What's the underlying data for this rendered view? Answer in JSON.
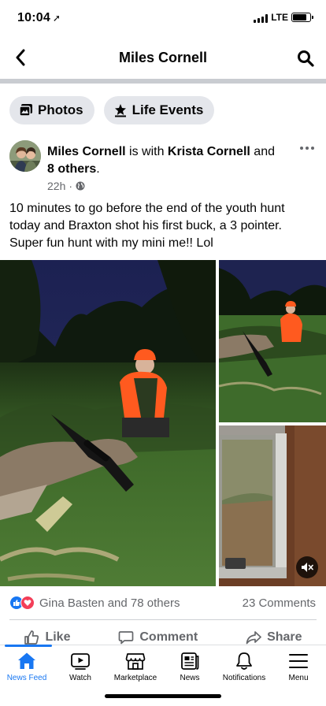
{
  "status_bar": {
    "time": "10:04",
    "network": "LTE"
  },
  "header": {
    "title": "Miles Cornell"
  },
  "chips": [
    {
      "label": "Photos"
    },
    {
      "label": "Life Events"
    }
  ],
  "post": {
    "author": "Miles Cornell",
    "with_text": " is with ",
    "tagged": "Krista Cornell",
    "and_text": " and ",
    "others": "8 others",
    "period": ".",
    "time": "22h",
    "dot": "·",
    "text": "10 minutes to go before the end of the youth hunt today and Braxton shot his first buck, a 3 pointer. Super fun hunt with my mini me!! Lol"
  },
  "reactions": {
    "summary": "Gina Basten and 78 others",
    "comments": "23 Comments"
  },
  "actions": [
    {
      "label": "Like"
    },
    {
      "label": "Comment"
    },
    {
      "label": "Share"
    }
  ],
  "tabs": [
    {
      "label": "News Feed",
      "icon": "home-icon",
      "active": true
    },
    {
      "label": "Watch",
      "icon": "watch-icon"
    },
    {
      "label": "Marketplace",
      "icon": "marketplace-icon"
    },
    {
      "label": "News",
      "icon": "news-icon"
    },
    {
      "label": "Notifications",
      "icon": "bell-icon"
    },
    {
      "label": "Menu",
      "icon": "menu-icon"
    }
  ],
  "colors": {
    "accent": "#1877f2",
    "secondary_text": "#65676b",
    "chip_bg": "#e4e6eb",
    "love": "#f33e58",
    "hunter_orange": "#ff5a1f"
  }
}
